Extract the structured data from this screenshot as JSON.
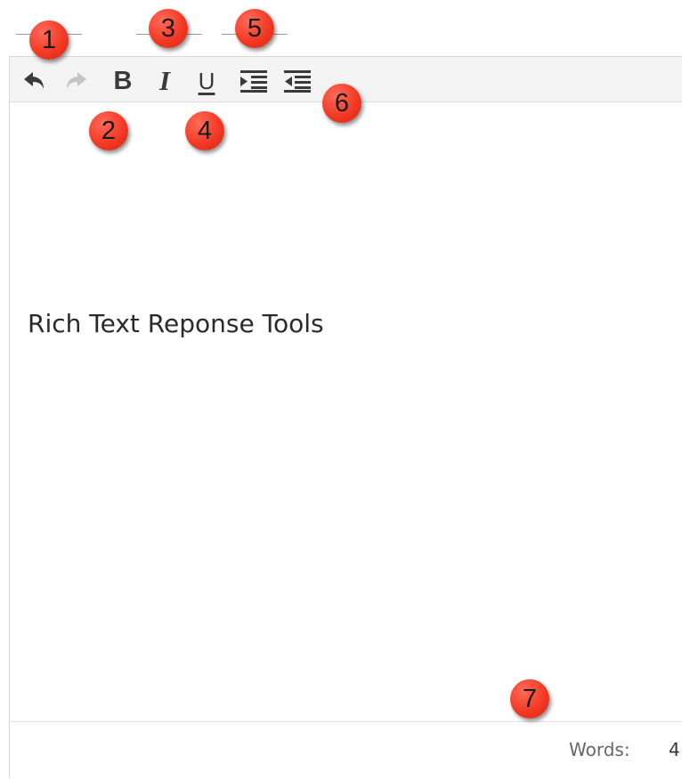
{
  "toolbar": {
    "buttons": [
      {
        "name": "undo",
        "icon": "undo-icon",
        "enabled": true
      },
      {
        "name": "redo",
        "icon": "redo-icon",
        "enabled": false
      },
      {
        "name": "bold",
        "icon": "bold-icon",
        "label": "B"
      },
      {
        "name": "italic",
        "icon": "italic-icon",
        "label": "I"
      },
      {
        "name": "underline",
        "icon": "underline-icon",
        "label": "U"
      },
      {
        "name": "indent",
        "icon": "indent-icon"
      },
      {
        "name": "outdent",
        "icon": "outdent-icon"
      }
    ]
  },
  "editor": {
    "content": "Rich Text Reponse Tools"
  },
  "status": {
    "words_label": "Words:",
    "words_count": "4"
  },
  "callouts": [
    "1",
    "2",
    "3",
    "4",
    "5",
    "6",
    "7"
  ],
  "colors": {
    "callout": "#f23a25",
    "toolbar_bg": "#f3f3f3",
    "icon": "#3a3a3a",
    "icon_disabled": "#c4c4c4"
  }
}
